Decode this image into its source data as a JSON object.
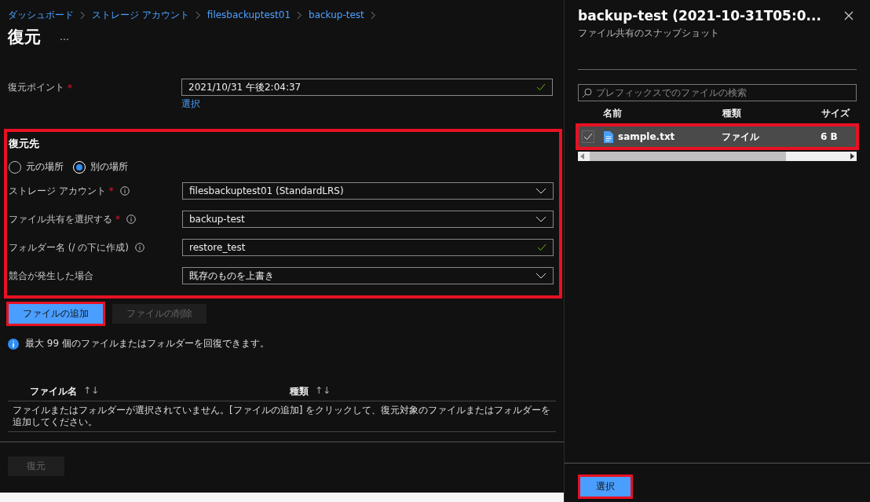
{
  "breadcrumb": [
    {
      "label": "ダッシュボード"
    },
    {
      "label": "ストレージ アカウント"
    },
    {
      "label": "filesbackuptest01"
    },
    {
      "label": "backup-test"
    }
  ],
  "page": {
    "title": "復元",
    "more": "…"
  },
  "restore_point": {
    "label": "復元ポイント",
    "required_mark": "*",
    "value": "2021/10/31 午後2:04:37",
    "valid": true,
    "link": "選択"
  },
  "destination": {
    "title": "復元先",
    "highlighted": true,
    "options": [
      {
        "label": "元の場所",
        "selected": false
      },
      {
        "label": "別の場所",
        "selected": true
      }
    ],
    "fields": [
      {
        "kind": "dropdown",
        "label": "ストレージ アカウント",
        "required_mark": "*",
        "info": true,
        "value": "filesbackuptest01 (StandardLRS)"
      },
      {
        "kind": "dropdown",
        "label": "ファイル共有を選択する",
        "required_mark": "*",
        "info": true,
        "value": "backup-test"
      },
      {
        "kind": "text",
        "label": "フォルダー名 (/ の下に作成)",
        "info": true,
        "value": "restore_test",
        "valid": true
      },
      {
        "kind": "dropdown",
        "label": "競合が発生した場合",
        "info": false,
        "value": "既存のものを上書き"
      }
    ]
  },
  "buttons": [
    {
      "label": "ファイルの追加",
      "disabled": false,
      "highlighted": true
    },
    {
      "label": "ファイルの削除",
      "disabled": true,
      "highlighted": false
    }
  ],
  "info": "最大 99 個のファイルまたはフォルダーを回復できます。",
  "table": {
    "columns": [
      {
        "label": "ファイル名",
        "sort": "↑↓"
      },
      {
        "label": "種類",
        "sort": "↑↓"
      }
    ],
    "empty": "ファイルまたはフォルダーが選択されていません。[ファイルの追加] をクリックして、復元対象のファイルまたはフォルダーを追加してください。"
  },
  "restore_button": {
    "label": "復元",
    "disabled": true
  },
  "panel": {
    "title": "backup-test (2021-10-31T05:0...",
    "subtitle": "ファイル共有のスナップショット",
    "search": {
      "placeholder": "プレフィックスでのファイルの検索"
    },
    "columns": [
      {
        "label": "名前"
      },
      {
        "label": "種類"
      },
      {
        "label": "サイズ"
      }
    ],
    "rows": [
      {
        "checked": true,
        "selected": true,
        "highlighted": true,
        "name": "sample.txt",
        "type": "ファイル",
        "size": "6 B"
      }
    ],
    "select_button": {
      "label": "選択",
      "highlighted": true
    }
  }
}
